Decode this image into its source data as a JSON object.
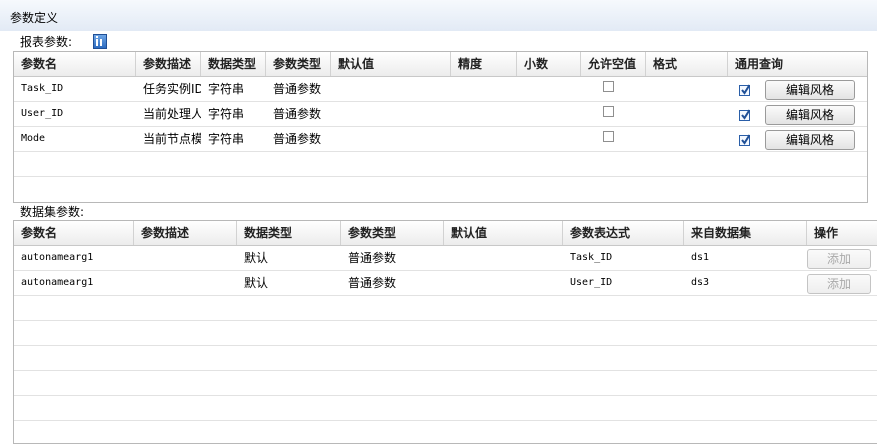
{
  "window": {
    "title": "参数定义"
  },
  "report_params": {
    "label": "报表参数:",
    "columns": [
      "参数名",
      "参数描述",
      "数据类型",
      "参数类型",
      "默认值",
      "精度",
      "小数",
      "允许空值",
      "格式",
      "通用查询"
    ],
    "rows": [
      {
        "name": "Task_ID",
        "desc": "任务实例ID",
        "data_type": "字符串",
        "param_type": "普通参数",
        "default": "",
        "precision": "",
        "decimal": "",
        "allow_null": false,
        "format": "",
        "common_query": true,
        "button": "编辑风格"
      },
      {
        "name": "User_ID",
        "desc": "当前处理人",
        "data_type": "字符串",
        "param_type": "普通参数",
        "default": "",
        "precision": "",
        "decimal": "",
        "allow_null": false,
        "format": "",
        "common_query": true,
        "button": "编辑风格"
      },
      {
        "name": "Mode",
        "desc": "当前节点模",
        "data_type": "字符串",
        "param_type": "普通参数",
        "default": "",
        "precision": "",
        "decimal": "",
        "allow_null": false,
        "format": "",
        "common_query": true,
        "button": "编辑风格"
      }
    ]
  },
  "dataset_params": {
    "label": "数据集参数:",
    "columns": [
      "参数名",
      "参数描述",
      "数据类型",
      "参数类型",
      "默认值",
      "参数表达式",
      "来自数据集",
      "操作"
    ],
    "rows": [
      {
        "name": "autonamearg1",
        "desc": "",
        "data_type": "默认",
        "param_type": "普通参数",
        "default": "",
        "expression": "Task_ID",
        "dataset": "ds1",
        "button": "添加"
      },
      {
        "name": "autonamearg1",
        "desc": "",
        "data_type": "默认",
        "param_type": "普通参数",
        "default": "",
        "expression": "User_ID",
        "dataset": "ds3",
        "button": "添加"
      }
    ]
  }
}
